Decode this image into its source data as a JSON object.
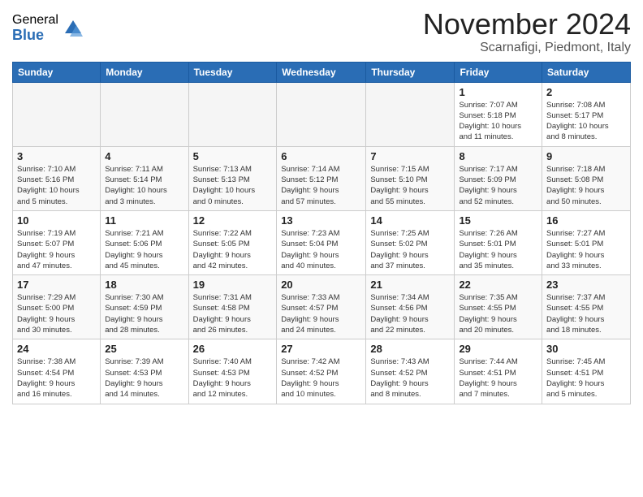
{
  "header": {
    "logo_general": "General",
    "logo_blue": "Blue",
    "month_title": "November 2024",
    "location": "Scarnafigi, Piedmont, Italy"
  },
  "weekdays": [
    "Sunday",
    "Monday",
    "Tuesday",
    "Wednesday",
    "Thursday",
    "Friday",
    "Saturday"
  ],
  "weeks": [
    [
      {
        "day": "",
        "info": ""
      },
      {
        "day": "",
        "info": ""
      },
      {
        "day": "",
        "info": ""
      },
      {
        "day": "",
        "info": ""
      },
      {
        "day": "",
        "info": ""
      },
      {
        "day": "1",
        "info": "Sunrise: 7:07 AM\nSunset: 5:18 PM\nDaylight: 10 hours\nand 11 minutes."
      },
      {
        "day": "2",
        "info": "Sunrise: 7:08 AM\nSunset: 5:17 PM\nDaylight: 10 hours\nand 8 minutes."
      }
    ],
    [
      {
        "day": "3",
        "info": "Sunrise: 7:10 AM\nSunset: 5:16 PM\nDaylight: 10 hours\nand 5 minutes."
      },
      {
        "day": "4",
        "info": "Sunrise: 7:11 AM\nSunset: 5:14 PM\nDaylight: 10 hours\nand 3 minutes."
      },
      {
        "day": "5",
        "info": "Sunrise: 7:13 AM\nSunset: 5:13 PM\nDaylight: 10 hours\nand 0 minutes."
      },
      {
        "day": "6",
        "info": "Sunrise: 7:14 AM\nSunset: 5:12 PM\nDaylight: 9 hours\nand 57 minutes."
      },
      {
        "day": "7",
        "info": "Sunrise: 7:15 AM\nSunset: 5:10 PM\nDaylight: 9 hours\nand 55 minutes."
      },
      {
        "day": "8",
        "info": "Sunrise: 7:17 AM\nSunset: 5:09 PM\nDaylight: 9 hours\nand 52 minutes."
      },
      {
        "day": "9",
        "info": "Sunrise: 7:18 AM\nSunset: 5:08 PM\nDaylight: 9 hours\nand 50 minutes."
      }
    ],
    [
      {
        "day": "10",
        "info": "Sunrise: 7:19 AM\nSunset: 5:07 PM\nDaylight: 9 hours\nand 47 minutes."
      },
      {
        "day": "11",
        "info": "Sunrise: 7:21 AM\nSunset: 5:06 PM\nDaylight: 9 hours\nand 45 minutes."
      },
      {
        "day": "12",
        "info": "Sunrise: 7:22 AM\nSunset: 5:05 PM\nDaylight: 9 hours\nand 42 minutes."
      },
      {
        "day": "13",
        "info": "Sunrise: 7:23 AM\nSunset: 5:04 PM\nDaylight: 9 hours\nand 40 minutes."
      },
      {
        "day": "14",
        "info": "Sunrise: 7:25 AM\nSunset: 5:02 PM\nDaylight: 9 hours\nand 37 minutes."
      },
      {
        "day": "15",
        "info": "Sunrise: 7:26 AM\nSunset: 5:01 PM\nDaylight: 9 hours\nand 35 minutes."
      },
      {
        "day": "16",
        "info": "Sunrise: 7:27 AM\nSunset: 5:01 PM\nDaylight: 9 hours\nand 33 minutes."
      }
    ],
    [
      {
        "day": "17",
        "info": "Sunrise: 7:29 AM\nSunset: 5:00 PM\nDaylight: 9 hours\nand 30 minutes."
      },
      {
        "day": "18",
        "info": "Sunrise: 7:30 AM\nSunset: 4:59 PM\nDaylight: 9 hours\nand 28 minutes."
      },
      {
        "day": "19",
        "info": "Sunrise: 7:31 AM\nSunset: 4:58 PM\nDaylight: 9 hours\nand 26 minutes."
      },
      {
        "day": "20",
        "info": "Sunrise: 7:33 AM\nSunset: 4:57 PM\nDaylight: 9 hours\nand 24 minutes."
      },
      {
        "day": "21",
        "info": "Sunrise: 7:34 AM\nSunset: 4:56 PM\nDaylight: 9 hours\nand 22 minutes."
      },
      {
        "day": "22",
        "info": "Sunrise: 7:35 AM\nSunset: 4:55 PM\nDaylight: 9 hours\nand 20 minutes."
      },
      {
        "day": "23",
        "info": "Sunrise: 7:37 AM\nSunset: 4:55 PM\nDaylight: 9 hours\nand 18 minutes."
      }
    ],
    [
      {
        "day": "24",
        "info": "Sunrise: 7:38 AM\nSunset: 4:54 PM\nDaylight: 9 hours\nand 16 minutes."
      },
      {
        "day": "25",
        "info": "Sunrise: 7:39 AM\nSunset: 4:53 PM\nDaylight: 9 hours\nand 14 minutes."
      },
      {
        "day": "26",
        "info": "Sunrise: 7:40 AM\nSunset: 4:53 PM\nDaylight: 9 hours\nand 12 minutes."
      },
      {
        "day": "27",
        "info": "Sunrise: 7:42 AM\nSunset: 4:52 PM\nDaylight: 9 hours\nand 10 minutes."
      },
      {
        "day": "28",
        "info": "Sunrise: 7:43 AM\nSunset: 4:52 PM\nDaylight: 9 hours\nand 8 minutes."
      },
      {
        "day": "29",
        "info": "Sunrise: 7:44 AM\nSunset: 4:51 PM\nDaylight: 9 hours\nand 7 minutes."
      },
      {
        "day": "30",
        "info": "Sunrise: 7:45 AM\nSunset: 4:51 PM\nDaylight: 9 hours\nand 5 minutes."
      }
    ]
  ]
}
